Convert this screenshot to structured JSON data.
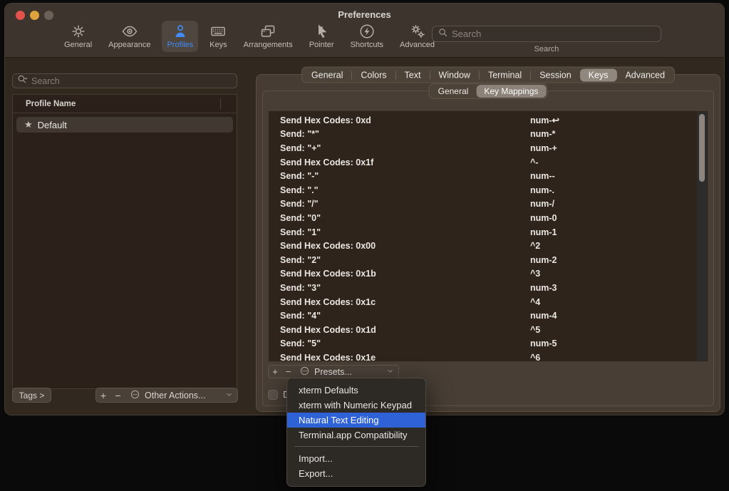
{
  "window": {
    "title": "Preferences"
  },
  "toolbar": {
    "items": [
      {
        "label": "General"
      },
      {
        "label": "Appearance"
      },
      {
        "label": "Profiles"
      },
      {
        "label": "Keys"
      },
      {
        "label": "Arrangements"
      },
      {
        "label": "Pointer"
      },
      {
        "label": "Shortcuts"
      },
      {
        "label": "Advanced"
      }
    ],
    "selected_item": "Profiles",
    "search_placeholder": "Search",
    "search_label": "Search"
  },
  "sidebar": {
    "search_placeholder": "Search",
    "table_header": "Profile Name",
    "profiles": [
      {
        "star": "★",
        "name": "Default",
        "selected": true
      }
    ],
    "tags_button": "Tags >",
    "add_button": "+",
    "remove_button": "−",
    "other_actions_label": "Other Actions..."
  },
  "profile_tabs": {
    "items": [
      {
        "label": "General"
      },
      {
        "label": "Colors"
      },
      {
        "label": "Text"
      },
      {
        "label": "Window"
      },
      {
        "label": "Terminal"
      },
      {
        "label": "Session"
      },
      {
        "label": "Keys"
      },
      {
        "label": "Advanced"
      }
    ],
    "selected": "Keys"
  },
  "keys_subtabs": {
    "items": [
      {
        "label": "General"
      },
      {
        "label": "Key Mappings"
      }
    ],
    "selected": "Key Mappings"
  },
  "keymap": {
    "rows": [
      {
        "action": "Send Hex Codes: 0xd",
        "key": "num-↩"
      },
      {
        "action": "Send: \"*\"",
        "key": "num-*"
      },
      {
        "action": "Send: \"+\"",
        "key": "num-+"
      },
      {
        "action": "Send Hex Codes: 0x1f",
        "key": "^-"
      },
      {
        "action": "Send: \"-\"",
        "key": "num--"
      },
      {
        "action": "Send: \".\"",
        "key": "num-."
      },
      {
        "action": "Send: \"/\"",
        "key": "num-/"
      },
      {
        "action": "Send: \"0\"",
        "key": "num-0"
      },
      {
        "action": "Send: \"1\"",
        "key": "num-1"
      },
      {
        "action": "Send Hex Codes: 0x00",
        "key": "^2"
      },
      {
        "action": "Send: \"2\"",
        "key": "num-2"
      },
      {
        "action": "Send Hex Codes: 0x1b",
        "key": "^3"
      },
      {
        "action": "Send: \"3\"",
        "key": "num-3"
      },
      {
        "action": "Send Hex Codes: 0x1c",
        "key": "^4"
      },
      {
        "action": "Send: \"4\"",
        "key": "num-4"
      },
      {
        "action": "Send Hex Codes: 0x1d",
        "key": "^5"
      },
      {
        "action": "Send: \"5\"",
        "key": "num-5"
      },
      {
        "action": "Send Hex Codes: 0x1e",
        "key": "^6"
      }
    ],
    "add_button": "+",
    "remove_button": "−",
    "presets_label": "Presets...",
    "delete_checkbox_label": "Del"
  },
  "presets_menu": {
    "items": [
      {
        "label": "xterm Defaults"
      },
      {
        "label": "xterm with Numeric Keypad"
      },
      {
        "label": "Natural Text Editing",
        "highlighted": true
      },
      {
        "label": "Terminal.app Compatibility"
      },
      {
        "label": "Import..."
      },
      {
        "label": "Export..."
      }
    ],
    "highlighted_item": "Natural Text Editing"
  },
  "colors": {
    "accent_blue": "#3f8bf8",
    "menu_highlight": "#2e62d6",
    "window_chrome": "#3d352d",
    "content_background": "#31281f",
    "traffic_red": "#e1524b",
    "traffic_yellow": "#dda43c",
    "traffic_gray": "#6b6159"
  }
}
